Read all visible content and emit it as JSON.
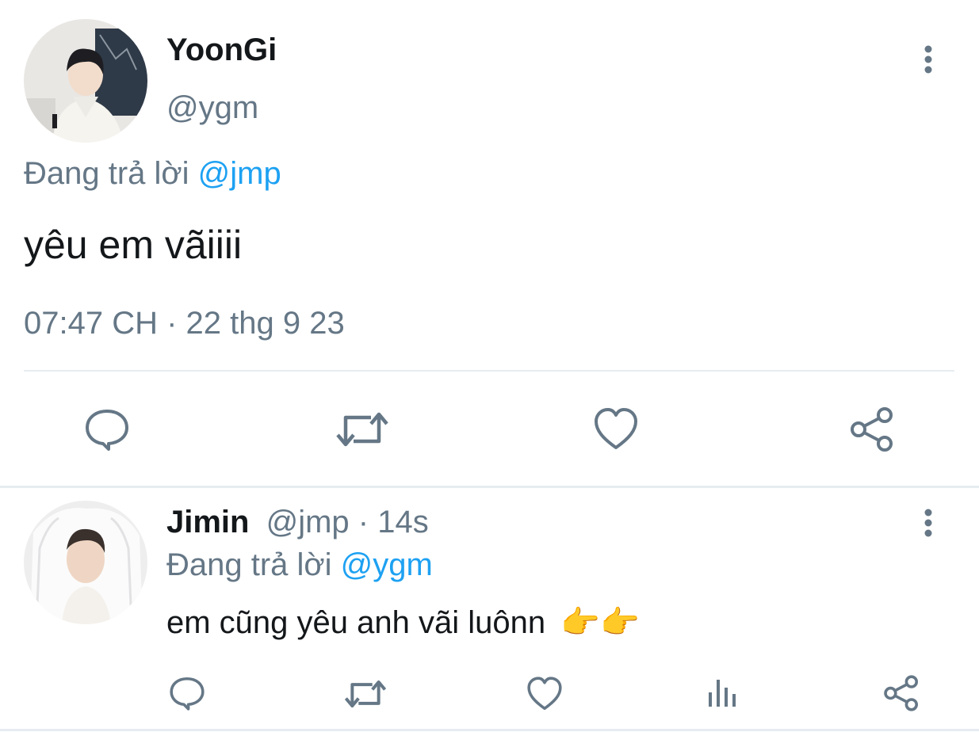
{
  "main_tweet": {
    "display_name": "YoonGi",
    "handle": "@ygm",
    "reply_prefix": "Đang trả lời",
    "reply_to": "@jmp",
    "text": "yêu em vãiiii",
    "timestamp": "07:47 CH · 22 thg 9 23",
    "actions": [
      "reply-icon",
      "retweet-icon",
      "like-icon",
      "share-icon"
    ]
  },
  "reply_tweet": {
    "display_name": "Jimin",
    "handle": "@jmp",
    "separator": " · ",
    "time_ago": "14s",
    "reply_prefix": "Đang trả lời",
    "reply_to": "@ygm",
    "text": "em cũng yêu anh vãi luônn",
    "emoji": "👉👉",
    "actions": [
      "reply-icon",
      "retweet-icon",
      "like-icon",
      "analytics-icon",
      "share-icon"
    ]
  },
  "colors": {
    "text": "#14171a",
    "muted": "#657786",
    "link": "#1da1f2",
    "divider": "#e6ecf0"
  }
}
